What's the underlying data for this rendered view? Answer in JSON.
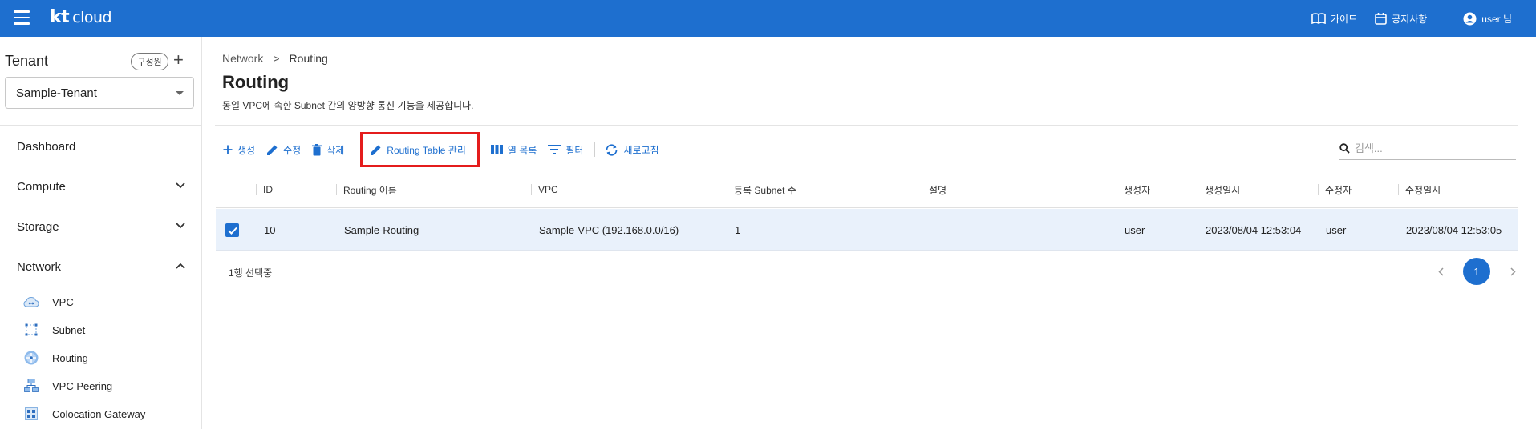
{
  "app": {
    "logo_bold": "kt",
    "logo_rest": "cloud"
  },
  "topbar": {
    "guide": "가이드",
    "notice": "공지사항",
    "user": "user 님"
  },
  "sidebar": {
    "tenant_title": "Tenant",
    "members_button": "구성원",
    "add_button": "+",
    "tenant_selected": "Sample-Tenant",
    "nav": {
      "dashboard": "Dashboard",
      "compute": "Compute",
      "storage": "Storage",
      "network": "Network"
    },
    "network_items": [
      "VPC",
      "Subnet",
      "Routing",
      "VPC Peering",
      "Colocation Gateway"
    ]
  },
  "breadcrumb": {
    "parent": "Network",
    "separator": ">",
    "current": "Routing"
  },
  "page": {
    "title": "Routing",
    "description": "동일 VPC에 속한 Subnet 간의 양방향 통신 기능을 제공합니다."
  },
  "toolbar": {
    "create": "생성",
    "edit": "수정",
    "delete": "삭제",
    "routing_table": "Routing Table 관리",
    "columns": "열 목록",
    "filter": "필터",
    "refresh": "새로고침",
    "search_placeholder": "검색..."
  },
  "table": {
    "headers": [
      "ID",
      "Routing 이름",
      "VPC",
      "등록 Subnet 수",
      "설명",
      "생성자",
      "생성일시",
      "수정자",
      "수정일시"
    ],
    "rows": [
      {
        "selected": true,
        "id": "10",
        "name": "Sample-Routing",
        "vpc": "Sample-VPC (192.168.0.0/16)",
        "subnet_count": "1",
        "description": "",
        "creator": "user",
        "created_at": "2023/08/04 12:53:04",
        "modifier": "user",
        "modified_at": "2023/08/04 12:53:05"
      }
    ],
    "selection_status": "1행 선택중"
  },
  "pagination": {
    "current_page": "1"
  },
  "colors": {
    "primary": "#1e6fcf",
    "highlight_border": "#e41c1c",
    "selected_row": "#e9f1fb"
  }
}
